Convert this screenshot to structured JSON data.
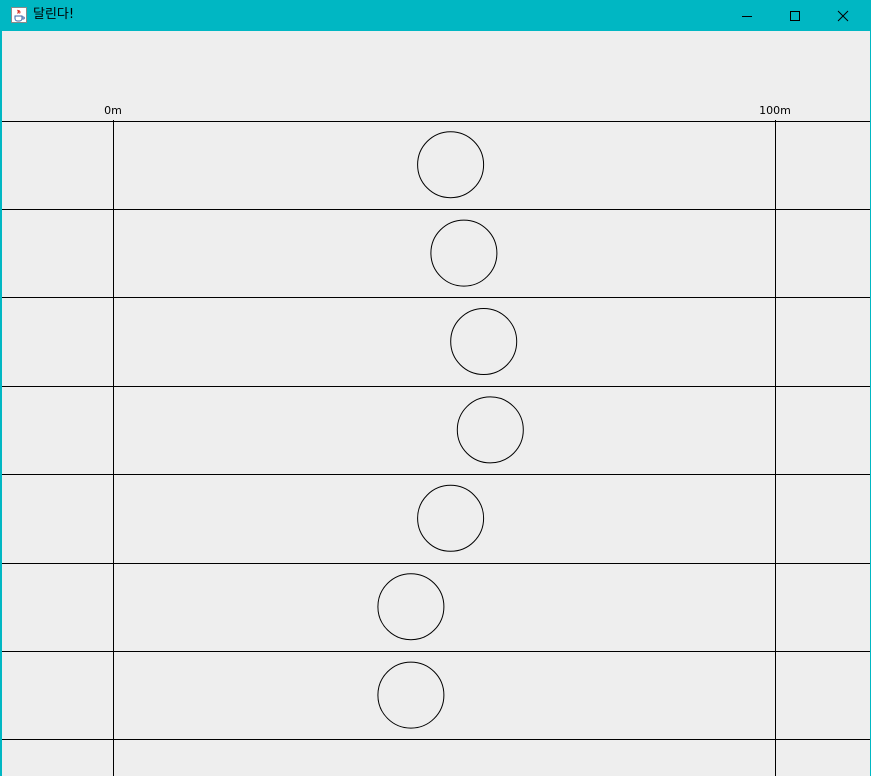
{
  "window": {
    "title": "달린다!",
    "titlebar_color": "#00b7c3",
    "icon": "java-cup-icon",
    "controls": {
      "minimize_icon": "minimize-icon",
      "maximize_icon": "maximize-icon",
      "close_icon": "close-icon"
    }
  },
  "track": {
    "start_label": "0m",
    "finish_label": "100m",
    "runner_positions_m": [
      51,
      53,
      56,
      57,
      51,
      45,
      45
    ]
  }
}
